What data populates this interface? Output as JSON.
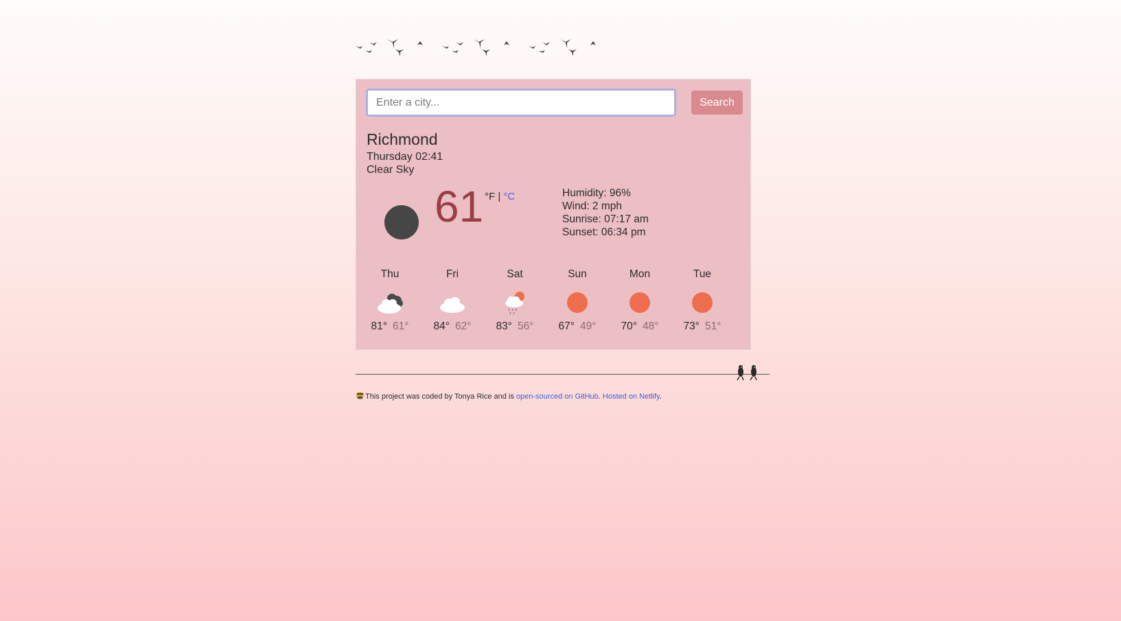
{
  "header": {
    "decoration_icon": "flying-birds-icon"
  },
  "search": {
    "placeholder": "Enter a city...",
    "value": "",
    "button_label": "Search"
  },
  "current": {
    "city": "Richmond",
    "datetime": "Thursday 02:41",
    "description": "Clear Sky",
    "icon": "moon-icon",
    "temperature": "61",
    "unit_f": "°F",
    "unit_separator": " | ",
    "unit_c": "°C",
    "humidity": "Humidity: 96%",
    "wind": "Wind: 2 mph",
    "sunrise": "Sunrise: 07:17 am",
    "sunset": "Sunset: 06:34 pm"
  },
  "forecast": [
    {
      "day": "Thu",
      "icon": "cloudy-night-icon",
      "high": "81°",
      "low": "61°"
    },
    {
      "day": "Fri",
      "icon": "cloud-icon",
      "high": "84°",
      "low": "62°"
    },
    {
      "day": "Sat",
      "icon": "sun-rain-icon",
      "high": "83°",
      "low": "56°"
    },
    {
      "day": "Sun",
      "icon": "sun-icon",
      "high": "67°",
      "low": "49°"
    },
    {
      "day": "Mon",
      "icon": "sun-icon",
      "high": "70°",
      "low": "48°"
    },
    {
      "day": "Tue",
      "icon": "sun-icon",
      "high": "73°",
      "low": "51°"
    }
  ],
  "footer": {
    "icon": "coder-emoji-icon",
    "text": "This project was coded by Tonya Rice and is ",
    "github_link": "open-sourced on GitHub",
    "separator": ". ",
    "netlify_link": "Hosted on Netlify",
    "end": "."
  },
  "colors": {
    "card_bg": "#ecbfc5",
    "search_button": "#d98a8f",
    "temperature": "#9b3d44",
    "sun": "#ee6d4e",
    "link": "#3b5fd9"
  }
}
